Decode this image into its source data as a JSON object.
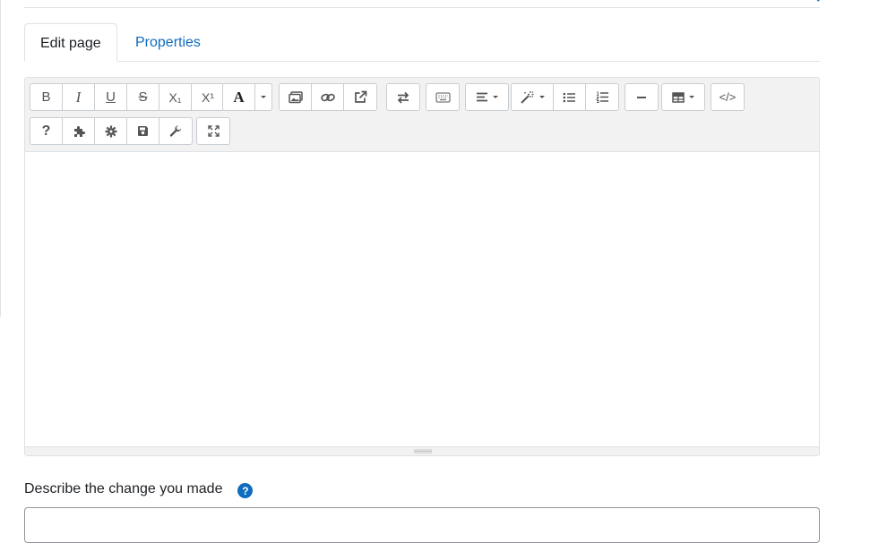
{
  "tabs": [
    {
      "label": "Edit page",
      "active": true
    },
    {
      "label": "Properties",
      "active": false
    }
  ],
  "toolbar": {
    "row1": {
      "bold": "B",
      "italic": "I",
      "underline": "U",
      "strikethrough": "S",
      "subscript": "X₁",
      "superscript": "X¹",
      "font_color": "A",
      "html_source": "</>"
    },
    "row2": {
      "help": "?"
    }
  },
  "change_label": "Describe the change you made",
  "help_icon": "?",
  "colors": {
    "accent": "#0f6cbf",
    "toolbar_bg": "#f2f2f2",
    "border": "#dee2e6"
  }
}
